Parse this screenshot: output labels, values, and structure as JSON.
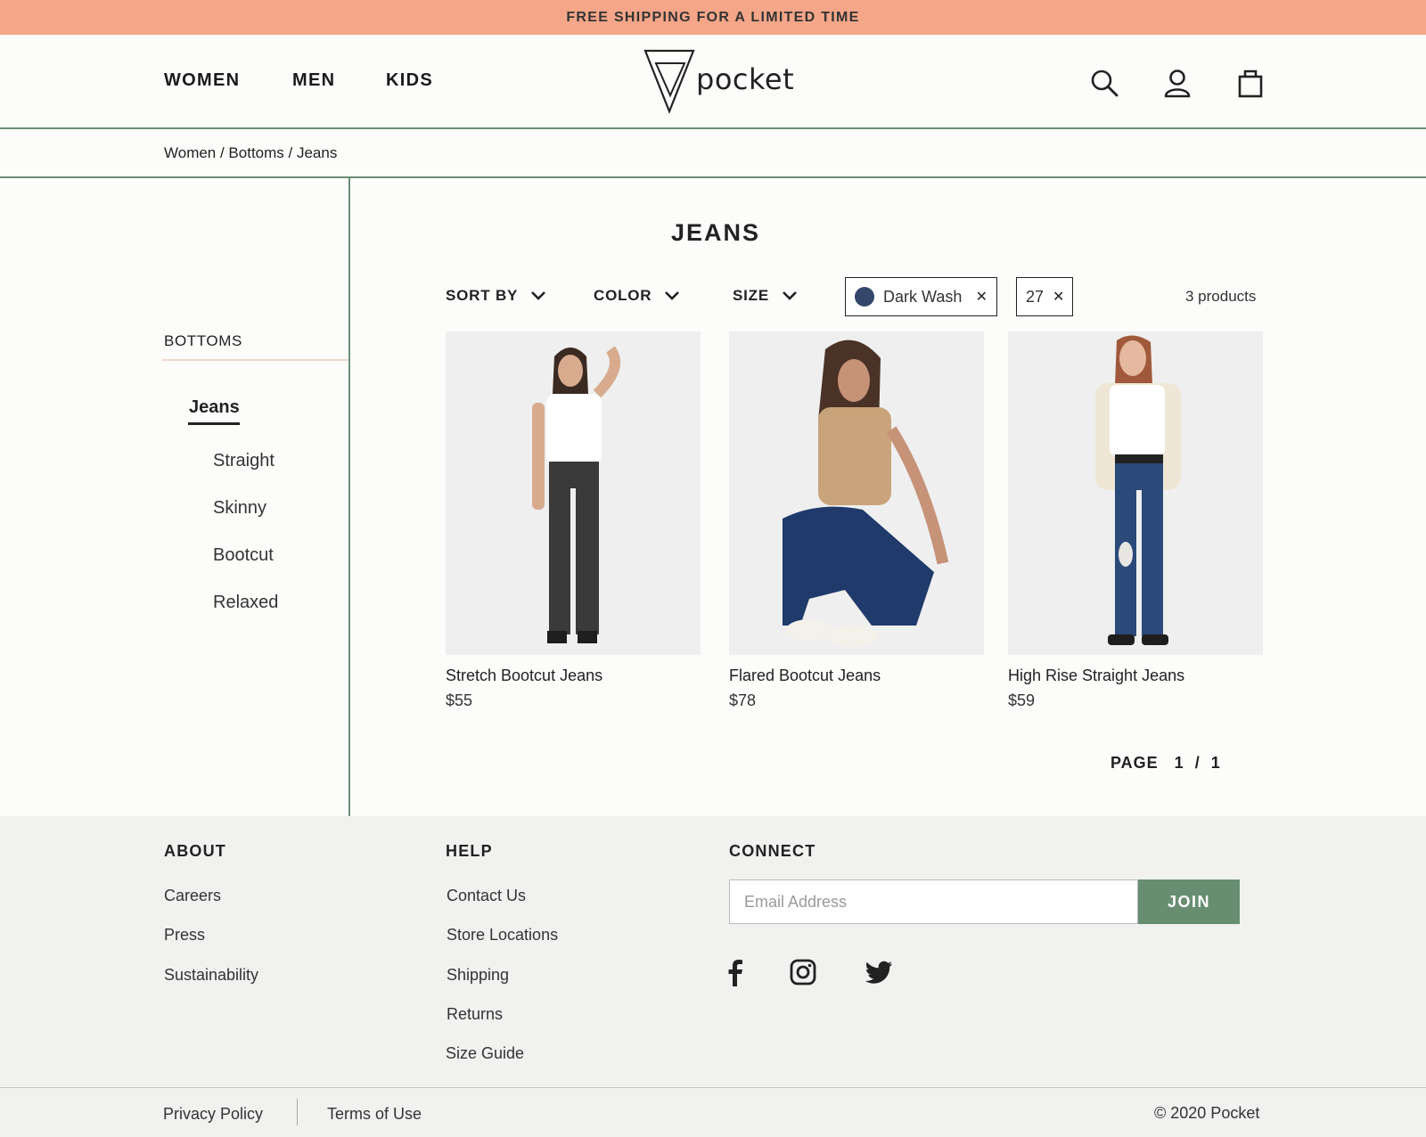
{
  "promo": {
    "text": "FREE SHIPPING FOR A LIMITED TIME"
  },
  "header": {
    "nav": [
      "WOMEN",
      "MEN",
      "KIDS"
    ],
    "logo_text": "pocket",
    "icons": [
      "search-icon",
      "account-icon",
      "cart-icon"
    ]
  },
  "breadcrumb": {
    "text": "Women / Bottoms / Jeans"
  },
  "sidebar": {
    "heading": "BOTTOMS",
    "active": "Jeans",
    "items": [
      "Straight",
      "Skinny",
      "Bootcut",
      "Relaxed"
    ]
  },
  "main": {
    "title": "JEANS",
    "filters": [
      "SORT BY",
      "COLOR",
      "SIZE"
    ],
    "chips": [
      {
        "label": "Dark Wash",
        "swatch_color": "#34476b"
      },
      {
        "label": "27"
      }
    ],
    "count": "3 products",
    "products": [
      {
        "name": "Stretch Bootcut Jeans",
        "price": "$55",
        "jeans_color": "#3a3a3a",
        "top_color": "#ffffff"
      },
      {
        "name": "Flared Bootcut Jeans",
        "price": "$78",
        "jeans_color": "#1f3a6b",
        "top_color": "#c9a47a"
      },
      {
        "name": "High Rise Straight Jeans",
        "price": "$59",
        "jeans_color": "#2b4a7a",
        "top_color": "#ffffff"
      }
    ],
    "pager": "PAGE   1  /  1"
  },
  "footer": {
    "about": {
      "heading": "ABOUT",
      "links": [
        "Careers",
        "Press",
        "Sustainability"
      ]
    },
    "help": {
      "heading": "HELP",
      "links": [
        "Contact Us",
        "Store Locations",
        "Shipping",
        "Returns",
        "Size Guide"
      ]
    },
    "connect": {
      "heading": "CONNECT",
      "email_placeholder": "Email Address",
      "join_label": "JOIN",
      "social": [
        "facebook-icon",
        "instagram-icon",
        "twitter-icon"
      ]
    },
    "bottom_links": [
      "Privacy Policy",
      "Terms of Use"
    ],
    "copyright": "© 2020 Pocket"
  },
  "colors": {
    "promo": "#f5a689",
    "accent_green": "#688e72",
    "footer_bg": "#f1f1f0"
  }
}
